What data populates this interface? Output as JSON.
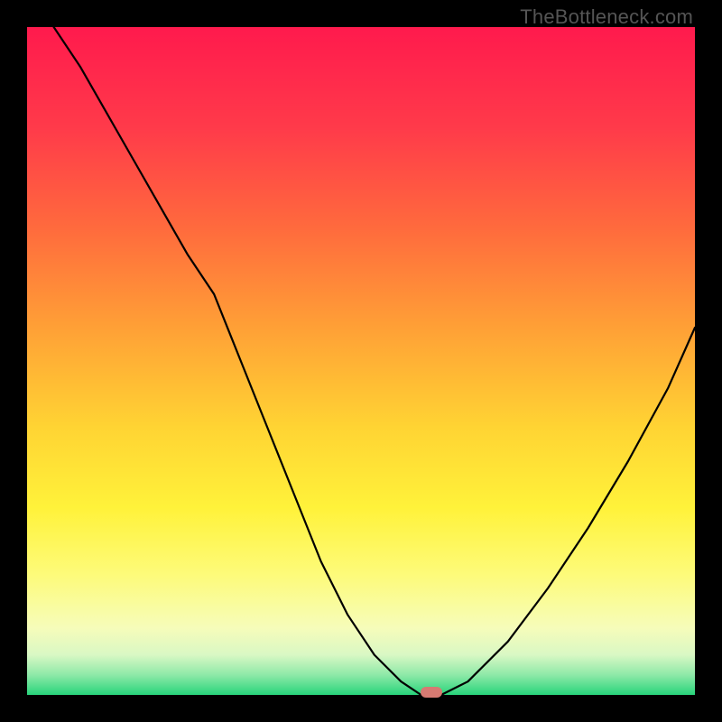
{
  "watermark": "TheBottleneck.com",
  "chart_data": {
    "type": "line",
    "title": "",
    "xlabel": "",
    "ylabel": "",
    "x": [
      0.04,
      0.08,
      0.12,
      0.16,
      0.2,
      0.24,
      0.28,
      0.32,
      0.36,
      0.4,
      0.44,
      0.48,
      0.52,
      0.56,
      0.59,
      0.62,
      0.66,
      0.72,
      0.78,
      0.84,
      0.9,
      0.96,
      1.0
    ],
    "y": [
      1.0,
      0.94,
      0.87,
      0.8,
      0.73,
      0.66,
      0.6,
      0.5,
      0.4,
      0.3,
      0.2,
      0.12,
      0.06,
      0.02,
      0.0,
      0.0,
      0.02,
      0.08,
      0.16,
      0.25,
      0.35,
      0.46,
      0.55
    ],
    "xlim": [
      0,
      1
    ],
    "ylim": [
      0,
      1
    ],
    "marker": {
      "x": 0.605,
      "y": 0.0
    },
    "gradient_stops": [
      {
        "pos": 0.0,
        "color": "#ff1a4d"
      },
      {
        "pos": 0.15,
        "color": "#ff3a4a"
      },
      {
        "pos": 0.3,
        "color": "#ff6a3d"
      },
      {
        "pos": 0.45,
        "color": "#ffa036"
      },
      {
        "pos": 0.6,
        "color": "#ffd433"
      },
      {
        "pos": 0.72,
        "color": "#fff23a"
      },
      {
        "pos": 0.82,
        "color": "#fdfb7a"
      },
      {
        "pos": 0.9,
        "color": "#f6fcba"
      },
      {
        "pos": 0.94,
        "color": "#d9f8c4"
      },
      {
        "pos": 0.97,
        "color": "#8ee9a8"
      },
      {
        "pos": 1.0,
        "color": "#28d47b"
      }
    ]
  }
}
